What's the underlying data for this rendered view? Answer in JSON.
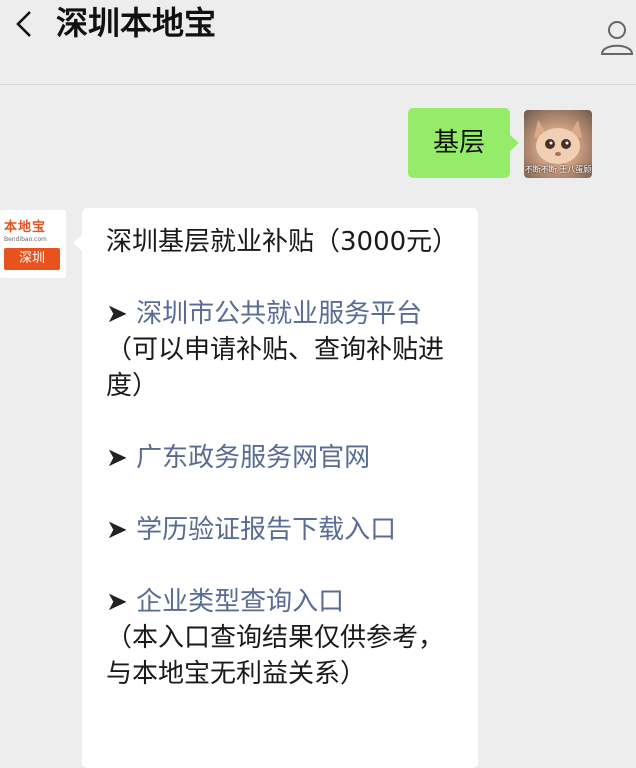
{
  "header": {
    "title": "深圳本地宝"
  },
  "outgoing": {
    "text": "基层",
    "avatar_caption": "不断不断 王八蛋顾"
  },
  "bot": {
    "logo_text": "本地宝",
    "logo_sub": "Bendibao.com",
    "logo_tag": "深圳"
  },
  "message": {
    "title": "深圳基层就业补贴（3000元）",
    "arrow": "➤",
    "items": [
      {
        "link": "深圳市公共就业服务平台",
        "note": "（可以申请补贴、查询补贴进度）"
      },
      {
        "link": "广东政务服务网官网",
        "note": ""
      },
      {
        "link": "学历验证报告下载入口",
        "note": ""
      },
      {
        "link": "企业类型查询入口",
        "note": "（本入口查询结果仅供参考，与本地宝无利益关系）"
      }
    ]
  },
  "colors": {
    "background": "#ededed",
    "out_bubble": "#95ec69",
    "link": "#586c94",
    "brand": "#e8521f"
  }
}
